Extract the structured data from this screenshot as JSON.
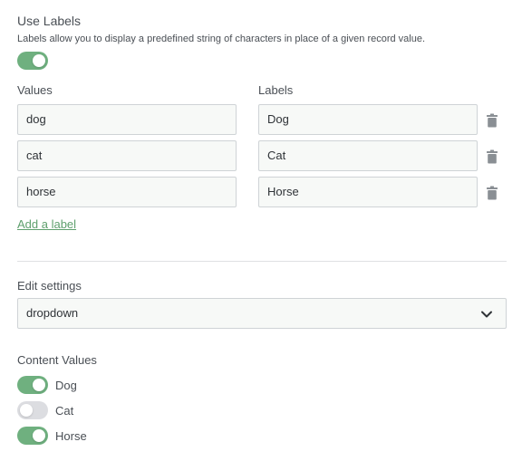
{
  "use_labels": {
    "title": "Use Labels",
    "description": "Labels allow you to display a predefined string of characters in place of a given record value.",
    "enabled": true
  },
  "columns": {
    "values": "Values",
    "labels": "Labels"
  },
  "rows": [
    {
      "value": "dog",
      "label": "Dog"
    },
    {
      "value": "cat",
      "label": "Cat"
    },
    {
      "value": "horse",
      "label": "Horse"
    }
  ],
  "add_label": "Add a label",
  "edit_settings": {
    "title": "Edit settings",
    "selected": "dropdown"
  },
  "content_values": {
    "title": "Content Values",
    "items": [
      {
        "label": "Dog",
        "enabled": true
      },
      {
        "label": "Cat",
        "enabled": false
      },
      {
        "label": "Horse",
        "enabled": true
      }
    ]
  },
  "colors": {
    "accent": "#6fb07f",
    "link": "#5fa06e",
    "toggle_off": "#dcdde1",
    "icon": "#8a8f94"
  },
  "icons": {
    "delete": "trash-icon",
    "dropdown": "chevron-down-icon"
  }
}
